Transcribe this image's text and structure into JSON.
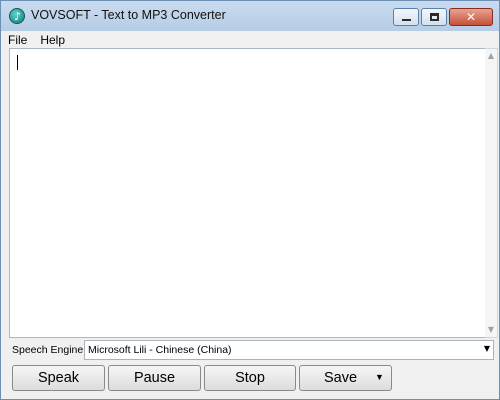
{
  "window": {
    "title": "VOVSOFT - Text to MP3 Converter"
  },
  "menu": {
    "items": [
      "File",
      "Help"
    ]
  },
  "editor": {
    "text": ""
  },
  "engine": {
    "label": "Speech Engine:",
    "selected": "Microsoft Lili - Chinese (China)"
  },
  "buttons": {
    "speak": "Speak",
    "pause": "Pause",
    "stop": "Stop",
    "save": "Save"
  },
  "icons": {
    "app": "music-note-icon",
    "minimize": "minimize-icon",
    "maximize": "maximize-icon",
    "close": "close-icon",
    "dropdown": "chevron-down-icon"
  },
  "colors": {
    "titlebar": "#c0d4ec",
    "close_button": "#c45139"
  }
}
